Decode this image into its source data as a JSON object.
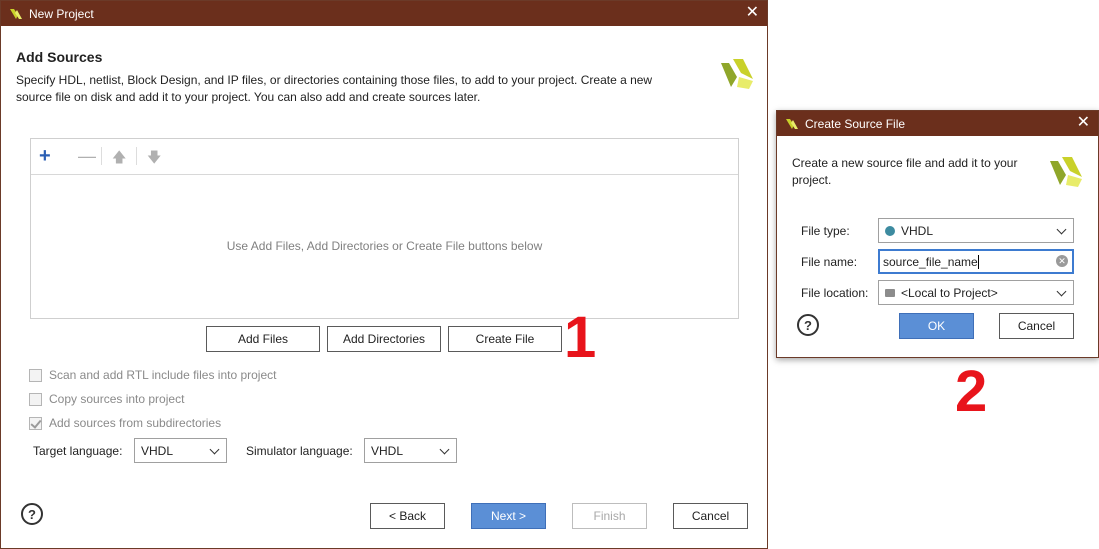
{
  "new_project": {
    "title": "New Project",
    "heading": "Add Sources",
    "description_line1": "Specify HDL, netlist, Block Design, and IP files, or directories containing those files, to add to your project. Create a new",
    "description_line2": "source file on disk and add it to your project. You can also add and create sources later.",
    "empty_hint": "Use Add Files, Add Directories or Create File buttons below",
    "add_files": "Add Files",
    "add_directories": "Add Directories",
    "create_file": "Create File",
    "checkboxes": [
      {
        "label": "Scan and add RTL include files into project",
        "checked": false
      },
      {
        "label": "Copy sources into project",
        "checked": false
      },
      {
        "label": "Add sources from subdirectories",
        "checked": true
      }
    ],
    "target_language_label": "Target language:",
    "target_language_value": "VHDL",
    "simulator_language_label": "Simulator language:",
    "simulator_language_value": "VHDL",
    "back": "< Back",
    "next": "Next >",
    "finish": "Finish",
    "cancel": "Cancel",
    "help": "?"
  },
  "create_source_file": {
    "title": "Create Source File",
    "description_line1": "Create a new source file and add it to your",
    "description_line2": "project.",
    "file_type_label": "File type:",
    "file_type_value": "VHDL",
    "file_name_label": "File name:",
    "file_name_value": "source_file_name",
    "file_location_label": "File location:",
    "file_location_value": "<Local to Project>",
    "ok": "OK",
    "cancel": "Cancel",
    "help": "?"
  },
  "annotations": {
    "step1": "1",
    "step2": "2",
    "color": "#e8141b"
  },
  "colors": {
    "titlebar": "#6b2f1c",
    "primary_button": "#5b8fd6",
    "vhdl_dot": "#3d8ba0"
  }
}
